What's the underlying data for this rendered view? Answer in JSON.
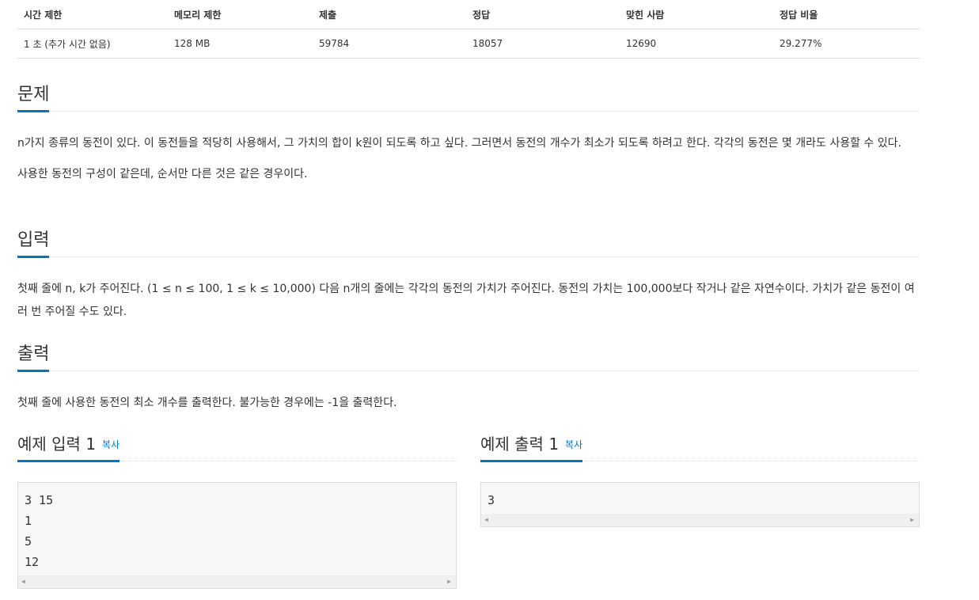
{
  "info_table": {
    "headers": [
      "시간 제한",
      "메모리 제한",
      "제출",
      "정답",
      "맞힌 사람",
      "정답 비율"
    ],
    "row": [
      "1 초 (추가 시간 없음)",
      "128 MB",
      "59784",
      "18057",
      "12690",
      "29.277%"
    ]
  },
  "problem": {
    "title": "문제",
    "paragraphs": [
      "n가지 종류의 동전이 있다. 이 동전들을 적당히 사용해서, 그 가치의 합이 k원이 되도록 하고 싶다. 그러면서 동전의 개수가 최소가 되도록 하려고 한다. 각각의 동전은 몇 개라도 사용할 수 있다.",
      "사용한 동전의 구성이 같은데, 순서만 다른 것은 같은 경우이다."
    ]
  },
  "input": {
    "title": "입력",
    "paragraph": "첫째 줄에 n, k가 주어진다. (1 ≤ n ≤ 100, 1 ≤ k ≤ 10,000) 다음 n개의 줄에는 각각의 동전의 가치가 주어진다. 동전의 가치는 100,000보다 작거나 같은 자연수이다. 가치가 같은 동전이 여러 번 주어질 수도 있다."
  },
  "output": {
    "title": "출력",
    "paragraph": "첫째 줄에 사용한 동전의 최소 개수를 출력한다. 불가능한 경우에는 -1을 출력한다."
  },
  "sample_input": {
    "title": "예제 입력 1",
    "copy_label": "복사",
    "lines": [
      "3 15",
      "1",
      "5",
      "12"
    ]
  },
  "sample_output": {
    "title": "예제 출력 1",
    "copy_label": "복사",
    "lines": [
      "3"
    ]
  },
  "colors": {
    "accent": "#0076c0",
    "sample_bg": "#f7f7f9",
    "border": "#dddddd"
  }
}
